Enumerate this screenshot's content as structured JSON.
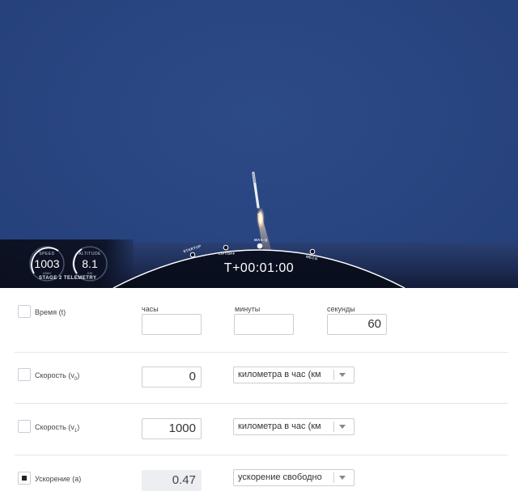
{
  "broadcast": {
    "speed": {
      "label": "SPEED",
      "value": "1003",
      "unit": "KM/H"
    },
    "altitude": {
      "label": "ALTITUDE",
      "value": "8.1",
      "unit": "KM"
    },
    "stage_label": "STAGE 2 TELEMETRY",
    "timer": "T+00:01:00",
    "milestones": [
      "STARTUP",
      "LIFTOFF",
      "MAX-Q",
      "MECO"
    ]
  },
  "form": {
    "columns": {
      "hours": "часы",
      "minutes": "минуты",
      "seconds": "секунды"
    },
    "rows": {
      "time": {
        "label_main": "Время",
        "label_var": "(t)",
        "checked": false,
        "hours": "",
        "minutes": "",
        "seconds": "60"
      },
      "speed0": {
        "label_main": "Скорость",
        "label_open": "(v",
        "label_sub": "0",
        "label_close": ")",
        "checked": false,
        "value": "0",
        "unit": "километра в час (км"
      },
      "speed1": {
        "label_main": "Скорость",
        "label_open": "(v",
        "label_sub": "1",
        "label_close": ")",
        "checked": false,
        "value": "1000",
        "unit": "километра в час (км"
      },
      "accel": {
        "label_main": "Ускорение",
        "label_var": "(a)",
        "checked": true,
        "value": "0.47",
        "unit": "ускорение свободно"
      }
    }
  },
  "colors": {
    "sky": "#2a4682",
    "hud": "#0a0e1c",
    "border": "#c9ced6",
    "readonly_bg": "#eceef2"
  }
}
